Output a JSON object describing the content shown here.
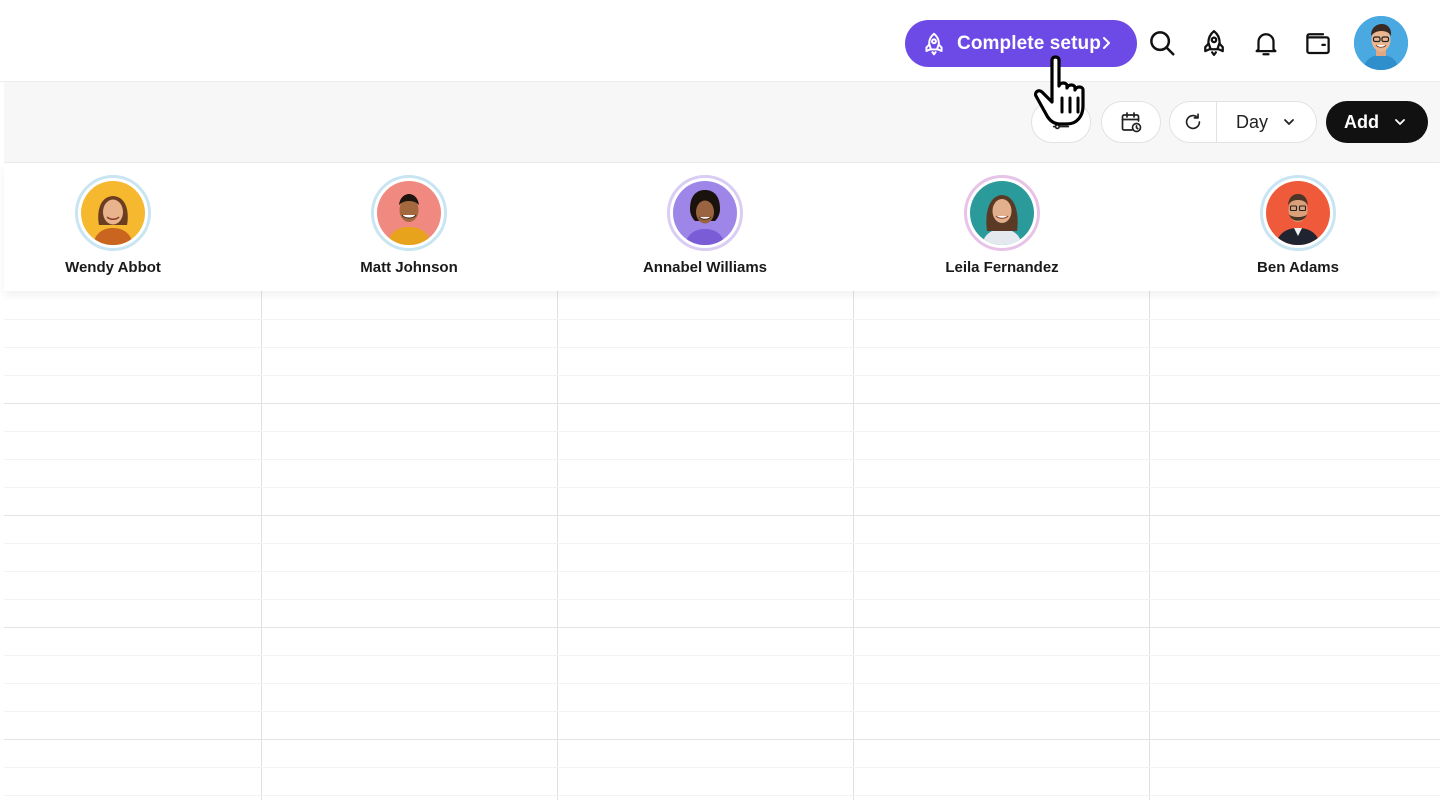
{
  "header": {
    "setup_button": {
      "label": "Complete setup",
      "icon": "rocket-icon",
      "trailing_icon": "chevron-right-icon"
    },
    "icons": [
      "search-icon",
      "rocket-icon",
      "bell-icon",
      "wallet-icon"
    ],
    "profile_avatar": "avatar"
  },
  "toolbar": {
    "filter_icon": "filter-icon",
    "schedule_icon": "calendar-clock-icon",
    "refresh_icon": "refresh-icon",
    "view_select": {
      "value": "Day"
    },
    "add_button": {
      "label": "Add"
    }
  },
  "staff": [
    {
      "name": "Wendy Abbot",
      "avatar_color": "#f5b82e"
    },
    {
      "name": "Matt Johnson",
      "avatar_color": "#f08a80"
    },
    {
      "name": "Annabel Williams",
      "avatar_color": "#9d86e8"
    },
    {
      "name": "Leila Fernandez",
      "avatar_color": "#2b9a9a"
    },
    {
      "name": "Ben Adams",
      "avatar_color": "#ee5a3a"
    }
  ],
  "colors": {
    "accent": "#6d4ae6",
    "add_button": "#111111",
    "grid_line": "#e0e0e0"
  }
}
